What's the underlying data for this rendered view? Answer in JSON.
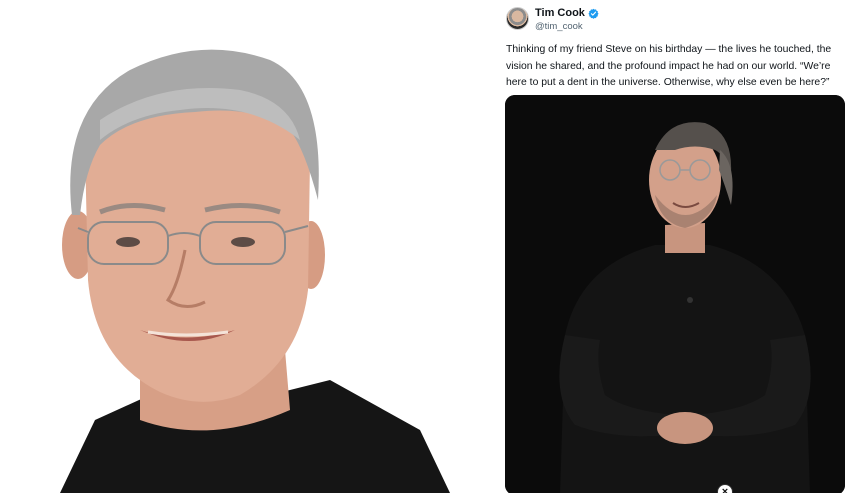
{
  "tweet": {
    "display_name": "Tim Cook",
    "handle": "@tim_cook",
    "text": "Thinking of my friend Steve on his birthday — the lives he touched, the vision he shared, and the profound impact he had on our world. “We’re here to put a dent in the universe. Otherwise, why else even be here?”"
  },
  "icons": {
    "verified": "verified-badge-icon",
    "close": "close-icon"
  },
  "colors": {
    "verified_blue": "#1d9bf0",
    "text_primary": "#0f1419",
    "text_secondary": "#536471",
    "media_background": "#0b0b0b"
  }
}
